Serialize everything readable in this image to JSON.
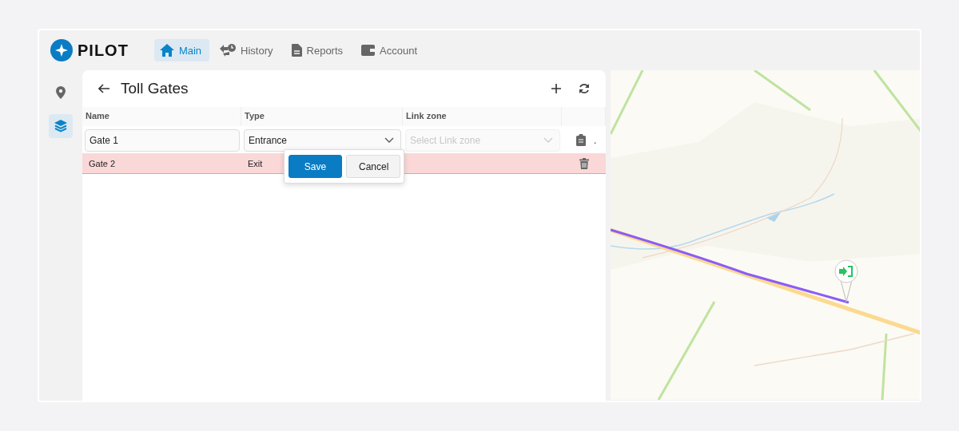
{
  "logo": {
    "text": "PILOT"
  },
  "nav": [
    {
      "label": "Main",
      "selected": true
    },
    {
      "label": "History",
      "selected": false
    },
    {
      "label": "Reports",
      "selected": false
    },
    {
      "label": "Account",
      "selected": false
    }
  ],
  "rail": [
    {
      "selected": false
    },
    {
      "selected": true
    }
  ],
  "panel": {
    "title": "Toll Gates"
  },
  "table": {
    "columns": [
      "Name",
      "Type",
      "Link zone"
    ],
    "edit_row": {
      "name": "Gate 1",
      "type": "Entrance",
      "link_zone_placeholder": "Select Link zone",
      "link_zone_disabled": true,
      "trailing": "."
    },
    "rows": [
      {
        "name": "Gate 2",
        "type": "Exit",
        "highlighted": true
      }
    ]
  },
  "popup": {
    "buttons": [
      {
        "label": "Save",
        "kind": "primary"
      },
      {
        "label": "Cancel",
        "kind": "secondary"
      }
    ]
  }
}
